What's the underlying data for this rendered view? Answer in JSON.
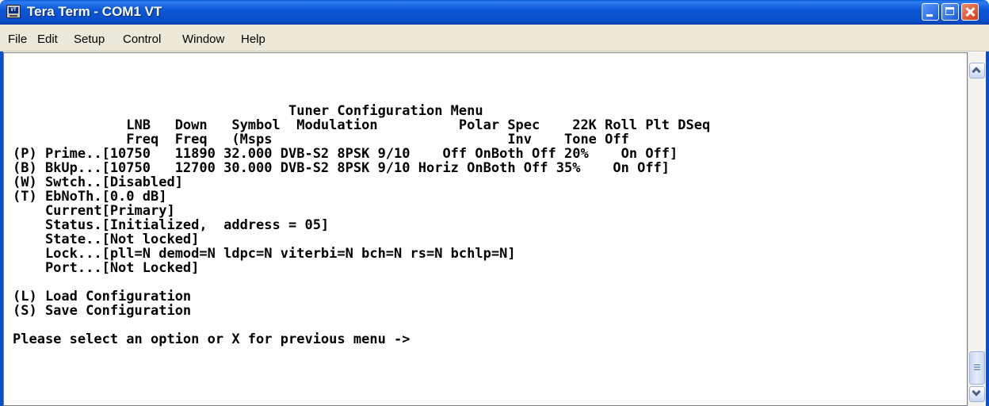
{
  "window": {
    "title": "Tera Term - COM1 VT",
    "icon_text": "VT"
  },
  "menu": [
    "File",
    "Edit",
    "Setup",
    "Control",
    "Window",
    "Help"
  ],
  "terminal": {
    "lines": [
      "                                  Tuner Configuration Menu",
      "              LNB   Down   Symbol  Modulation          Polar Spec    22K Roll Plt DSeq",
      "              Freq  Freq   (Msps                             Inv    Tone Off",
      "(P) Prime..[10750   11890 32.000 DVB-S2 8PSK 9/10    Off OnBoth Off 20%    On Off]",
      "(B) BkUp...[10750   12700 30.000 DVB-S2 8PSK 9/10 Horiz OnBoth Off 35%    On Off]",
      "(W) Swtch..[Disabled]",
      "(T) EbNoTh.[0.0 dB]",
      "    Current[Primary]",
      "    Status.[Initialized,  address = 05]",
      "    State..[Not locked]",
      "    Lock...[pll=N demod=N ldpc=N viterbi=N bch=N rs=N bchlp=N]",
      "    Port...[Not Locked]",
      "",
      "(L) Load Configuration",
      "(S) Save Configuration",
      "",
      "Please select an option or X for previous menu ->"
    ]
  }
}
